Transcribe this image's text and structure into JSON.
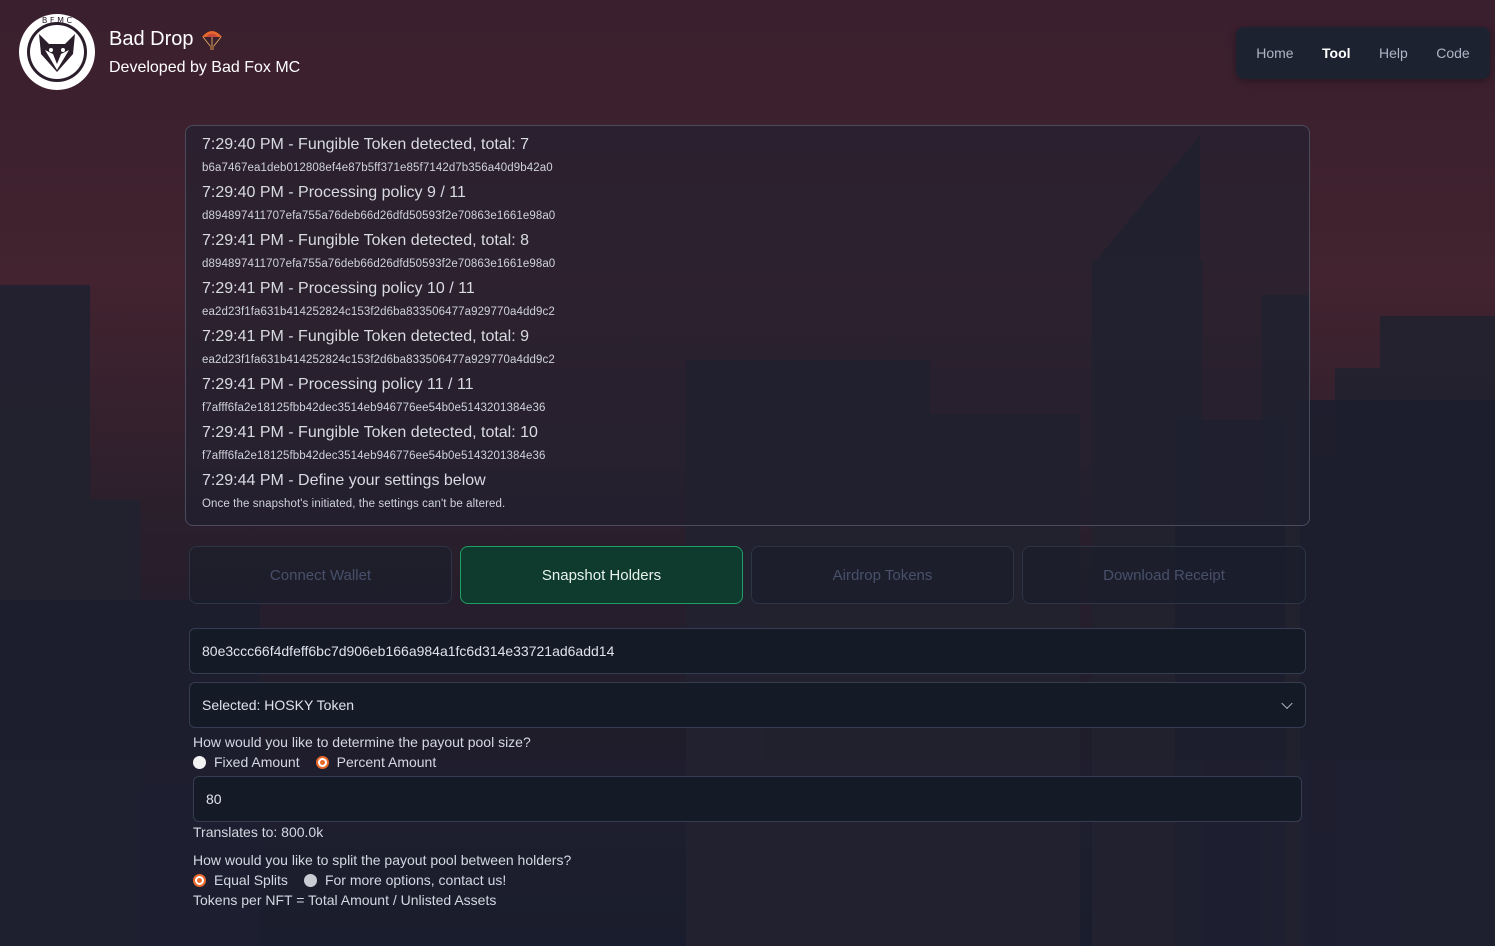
{
  "brand": {
    "title": "Bad Drop",
    "subtitle": "Developed by Bad Fox MC",
    "logo_icon": "fox-club-logo",
    "title_icon": "parachute-icon"
  },
  "nav": {
    "items": [
      {
        "label": "Home",
        "active": false
      },
      {
        "label": "Tool",
        "active": true
      },
      {
        "label": "Help",
        "active": false
      },
      {
        "label": "Code",
        "active": false
      }
    ]
  },
  "log": {
    "entries": [
      {
        "message": "7:29:40 PM - Fungible Token detected, total: 7",
        "detail": "b6a7467ea1deb012808ef4e87b5ff371e85f7142d7b356a40d9b42a0"
      },
      {
        "message": "7:29:40 PM - Processing policy 9 / 11",
        "detail": "d894897411707efa755a76deb66d26dfd50593f2e70863e1661e98a0"
      },
      {
        "message": "7:29:41 PM - Fungible Token detected, total: 8",
        "detail": "d894897411707efa755a76deb66d26dfd50593f2e70863e1661e98a0"
      },
      {
        "message": "7:29:41 PM - Processing policy 10 / 11",
        "detail": "ea2d23f1fa631b414252824c153f2d6ba833506477a929770a4dd9c2"
      },
      {
        "message": "7:29:41 PM - Fungible Token detected, total: 9",
        "detail": "ea2d23f1fa631b414252824c153f2d6ba833506477a929770a4dd9c2"
      },
      {
        "message": "7:29:41 PM - Processing policy 11 / 11",
        "detail": "f7afff6fa2e18125fbb42dec3514eb946776ee54b0e5143201384e36"
      },
      {
        "message": "7:29:41 PM - Fungible Token detected, total: 10",
        "detail": "f7afff6fa2e18125fbb42dec3514eb946776ee54b0e5143201384e36"
      },
      {
        "message": "7:29:44 PM - Define your settings below",
        "detail": "Once the snapshot's initiated, the settings can't be altered."
      }
    ]
  },
  "steps": [
    {
      "label": "Connect Wallet",
      "active": false
    },
    {
      "label": "Snapshot Holders",
      "active": true
    },
    {
      "label": "Airdrop Tokens",
      "active": false
    },
    {
      "label": "Download Receipt",
      "active": false
    }
  ],
  "form": {
    "policy_id_value": "80e3ccc66f4dfeff6bc7d906eb166a984a1fc6d314e33721ad6add14",
    "token_select_value": "Selected: HOSKY Token",
    "pool_question": "How would you like to determine the payout pool size?",
    "pool_options": {
      "fixed": "Fixed Amount",
      "percent": "Percent Amount",
      "selected": "percent"
    },
    "amount_value": "80",
    "translates_to": "Translates to: 800.0k",
    "split_question": "How would you like to split the payout pool between holders?",
    "split_options": {
      "equal": "Equal Splits",
      "other": "For more options, contact us!",
      "selected": "equal"
    },
    "formula": "Tokens per NFT = Total Amount / Unlisted Assets"
  },
  "colors": {
    "accent_orange": "#e8692b",
    "active_step_green": "#1f9f64",
    "panel_bg": "#1c2230"
  }
}
